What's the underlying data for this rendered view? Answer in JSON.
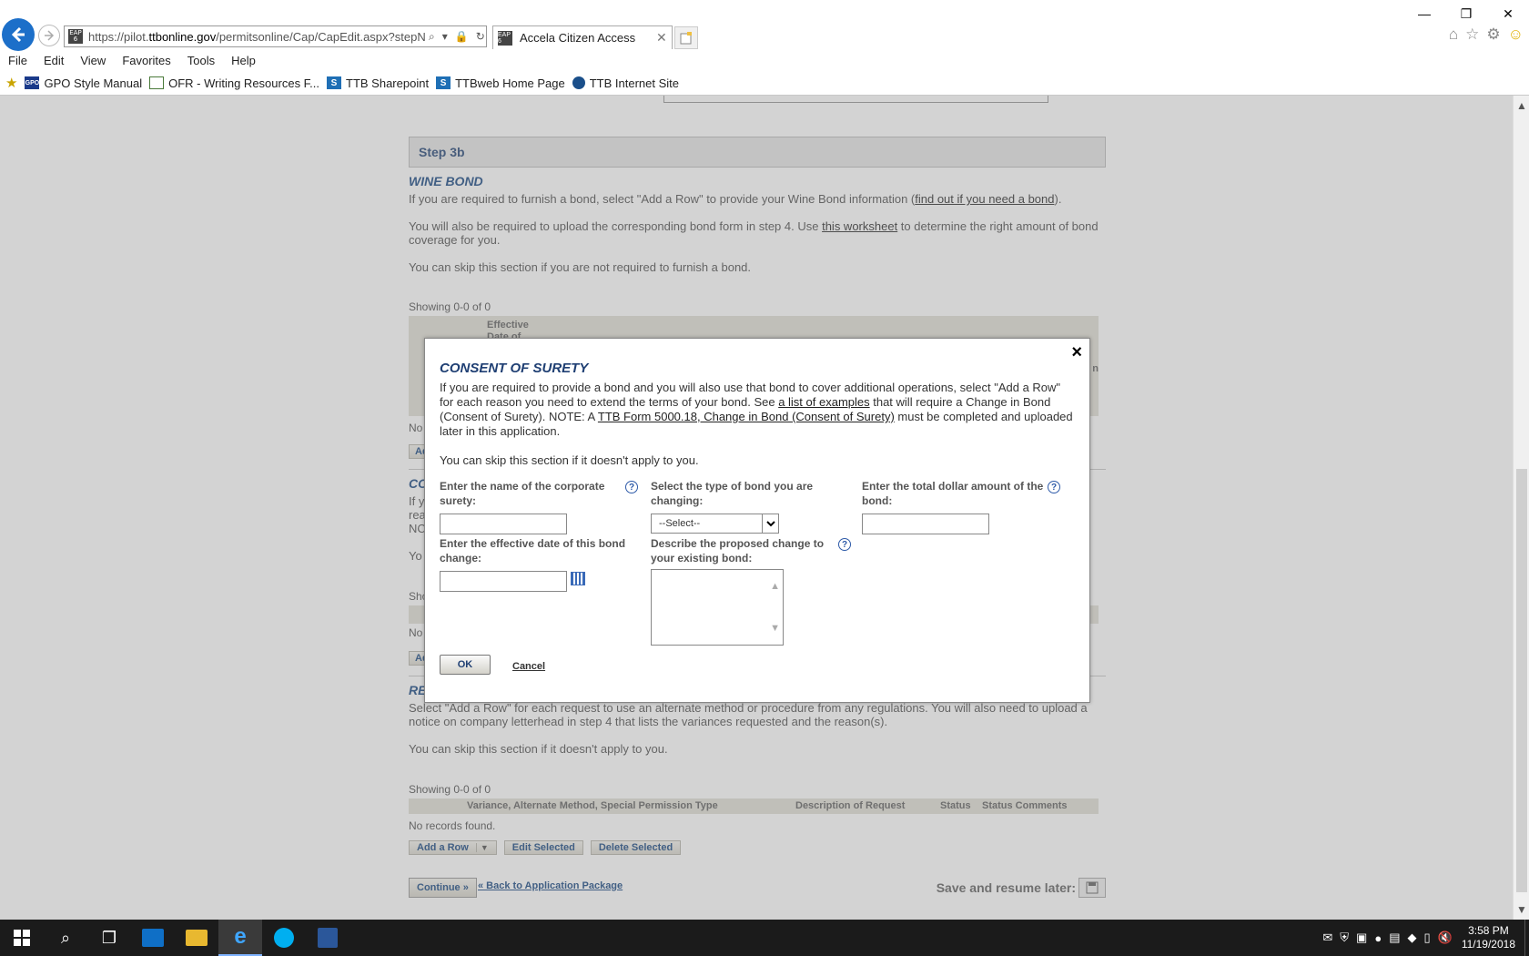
{
  "browser": {
    "url_prefix": "https://pilot.",
    "url_domain": "ttbonline.gov",
    "url_rest": "/permitsonline/Cap/CapEdit.aspx?stepNuml",
    "favicon_text": "EAP 6",
    "tab_title": "Accela Citizen Access",
    "menu": [
      "File",
      "Edit",
      "View",
      "Favorites",
      "Tools",
      "Help"
    ],
    "favorites": [
      {
        "label": "GPO Style Manual",
        "icon": "GPO",
        "color": "#1a3a8a"
      },
      {
        "label": "OFR - Writing Resources F...",
        "icon": "",
        "color": "#4a7a3a"
      },
      {
        "label": "TTB Sharepoint",
        "icon": "S",
        "color": "#1f6fb5"
      },
      {
        "label": "TTBweb Home Page",
        "icon": "S",
        "color": "#1f6fb5"
      },
      {
        "label": "TTB Internet Site",
        "icon": "",
        "color": "#1a4f8a"
      }
    ]
  },
  "page": {
    "step_header": "Step 3b",
    "wine_bond": {
      "title": "WINE BOND",
      "p1_before": "If you are required to furnish a bond, select \"Add a Row\" to provide your Wine Bond information (",
      "p1_link": "find out if you need a bond",
      "p1_after": ").",
      "p2_before": "You will also be required to upload the corresponding bond form in step 4. Use ",
      "p2_link": "this worksheet",
      "p2_after": " to determine the right amount of bond coverage for you.",
      "p3": "You can skip this section if you are not required to furnish a bond.",
      "showing": "Showing 0-0 of 0",
      "col_effective_l1": "Effective",
      "col_effective_l2": "Date of"
    },
    "partial": {
      "no1": "No",
      "ad1": "Ad",
      "co": "CO",
      "if": "If y",
      "rea": "rea",
      "nc": "NC",
      "yo": "Yo",
      "sho": "Sho",
      "no2": "No",
      "ad2": "Ad",
      "re": "RE",
      "n": "n"
    },
    "variance": {
      "p1": "Select \"Add a Row\" for each request to use an alternate method or procedure from any regulations. You will also need to upload a notice on company letterhead in step 4 that lists the variances requested and the reason(s).",
      "p2": "You can skip this section if it doesn't apply to you.",
      "showing": "Showing 0-0 of 0",
      "col1": "Variance, Alternate Method, Special Permission Type",
      "col2": "Description of Request",
      "col3": "Status",
      "col4": "Status Comments",
      "norec": "No records found.",
      "add_row": "Add a Row",
      "edit_selected": "Edit Selected",
      "delete_selected": "Delete Selected"
    },
    "continue_label": "Continue »",
    "back_label": "« Back to Application Package",
    "save_resume": "Save and resume later:"
  },
  "modal": {
    "close_glyph": "×",
    "title": "CONSENT OF SURETY",
    "intro_a": "If you are required to provide a bond and you will also use that bond to cover additional operations, select \"Add a Row\" for each reason you need to extend the terms of your bond. See ",
    "intro_link1": "a list of examples",
    "intro_b": " that will require a Change in Bond (Consent of Surety). NOTE: A ",
    "intro_link2": "TTB Form 5000.18, Change in Bond (Consent of Surety)",
    "intro_c": " must be completed and uploaded later in this application.",
    "skip": "You can skip this section if it doesn't apply to you.",
    "surety_label": "Enter the name of the corporate surety:",
    "bond_type_label": "Select the type of bond you are changing:",
    "bond_type_value": "--Select--",
    "amount_label": "Enter the total dollar amount of the bond:",
    "date_label": "Enter the effective date of this bond change:",
    "change_label": "Describe the proposed change to your existing bond:",
    "help_glyph": "?",
    "ok": "OK",
    "cancel": "Cancel"
  },
  "taskbar": {
    "time": "3:58 PM",
    "date": "11/19/2018"
  }
}
